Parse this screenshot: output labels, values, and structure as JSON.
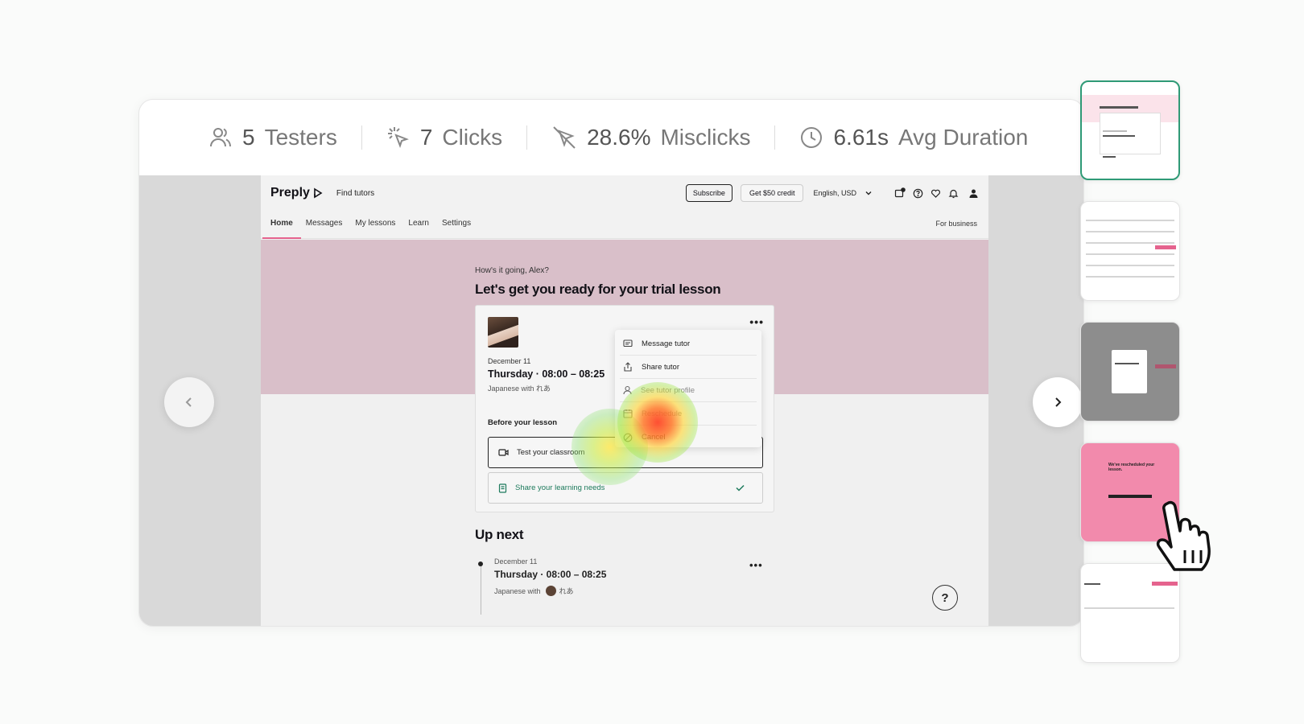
{
  "stats": {
    "testers": {
      "value": "5",
      "label": "Testers",
      "icon": "users-icon"
    },
    "clicks": {
      "value": "7",
      "label": "Clicks",
      "icon": "click-icon"
    },
    "misclicks": {
      "value": "28.6%",
      "label": "Misclicks",
      "icon": "misclick-icon"
    },
    "duration": {
      "value": "6.61s",
      "label": "Avg Duration",
      "icon": "clock-icon"
    }
  },
  "app": {
    "logo": "Preply",
    "find_tutors": "Find tutors",
    "subscribe": "Subscribe",
    "credit": "Get $50 credit",
    "language": "English, USD",
    "nav": [
      "Home",
      "Messages",
      "My lessons",
      "Learn",
      "Settings"
    ],
    "for_business": "For business",
    "greeting": "How's it going, Alex?",
    "hero_title": "Let's get you ready for your trial lesson",
    "lesson": {
      "date": "December 11",
      "time": "Thursday · 08:00 – 08:25",
      "with": "Japanese with れあ",
      "before": "Before your lesson",
      "task_1": "Test your classroom",
      "task_2": "Share your learning needs"
    },
    "menu": [
      "Message tutor",
      "Share tutor",
      "See tutor profile",
      "Reschedule",
      "Cancel"
    ],
    "upnext": {
      "title": "Up next",
      "date": "December 11",
      "time": "Thursday · 08:00 – 08:25",
      "with_prefix": "Japanese with",
      "tutor": "れあ"
    },
    "help": "?"
  },
  "thumb_4": {
    "heading": "We've rescheduled your lesson."
  },
  "colors": {
    "accent_pink": "#e5638e",
    "hero_bg": "#d9bfc9",
    "active_thumb_border": "#2f9a76",
    "success_green": "#1d7a5c"
  }
}
